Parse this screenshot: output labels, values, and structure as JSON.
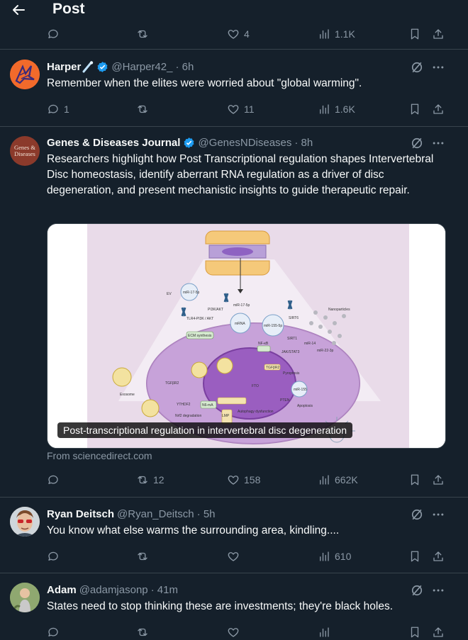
{
  "header": {
    "title": "Post",
    "back_icon": "arrow-left-icon"
  },
  "top_partial_actions": {
    "like": "4",
    "views": "1.1K"
  },
  "tweets": [
    {
      "name": "Harper",
      "handle": "@Harper42_",
      "time": "· 6h",
      "text": "Remember when the elites were worried about \"global warming\".",
      "replies": "1",
      "reposts": "",
      "likes": "11",
      "views": "1.6K"
    },
    {
      "name": "Genes & Diseases Journal",
      "handle": "@GenesNDiseases",
      "time": "· 8h",
      "avatar_text": "Genes & Diseases",
      "text": "Researchers highlight how Post Transcriptional regulation shapes Intervertebral Disc homeostasis, identify aberrant RNA regulation as a driver of disc degeneration, and present mechanistic insights to guide therapeutic repair.",
      "media_caption": "Post-transcriptional regulation in intervertebral disc degeneration",
      "link_source": "From sciencedirect.com",
      "replies": "",
      "reposts": "12",
      "likes": "158",
      "views": "662K"
    },
    {
      "name": "Ryan Deitsch",
      "handle": "@Ryan_Deitsch",
      "time": "· 5h",
      "text": "You know what else warms the surrounding area, kindling....",
      "replies": "",
      "reposts": "",
      "likes": "",
      "views": "610"
    },
    {
      "name": "Adam",
      "handle": "@adamjasonp",
      "time": "· 41m",
      "text": "States need to stop thinking these are investments; they're black holes."
    }
  ],
  "colors": {
    "background": "#15202b",
    "text": "#f7f9f9",
    "muted": "#8b98a5",
    "divider": "#38444d",
    "verified": "#1d9bf0"
  },
  "diagram_labels": [
    "PI3K/AKT",
    "miR-17-5p",
    "miR-17-5p",
    "mRNA",
    "miR-155-5p",
    "SIRT6",
    "TLR4-PI3K / AKT",
    "ECM synthesis",
    "NF-κB",
    "SIRT1",
    "miR-14",
    "miR-22-3p",
    "JAK/STAT3",
    "Nanoparticles",
    "EV",
    "TGFβR2",
    "Exosome",
    "FTO",
    "TGFβR2",
    "Pyroptosis",
    "YTHDF2",
    "N6-mA",
    "Nrf2 degradation",
    "LMP",
    "Autophagy dysfunction",
    "PTEN",
    "Apoptosis",
    "miR-155"
  ]
}
